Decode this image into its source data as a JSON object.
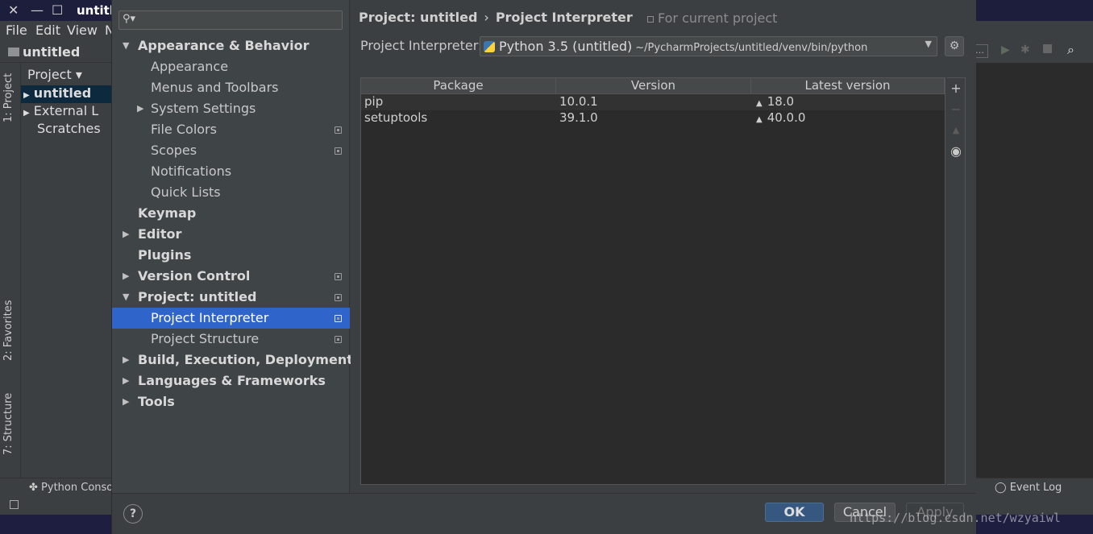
{
  "ide": {
    "title": "untitled",
    "menu": [
      "File",
      "Edit",
      "View",
      "N"
    ],
    "nav_crumb": "untitled",
    "project_header": "Project",
    "tree": [
      "untitled",
      "External L",
      "Scratches"
    ],
    "left_tabs": [
      "1: Project",
      "2: Favorites",
      "7: Structure"
    ],
    "python_console": "Python Conso",
    "event_log": "Event Log"
  },
  "dialog": {
    "search_placeholder": "",
    "nav": {
      "appearance_behavior": "Appearance & Behavior",
      "appearance": "Appearance",
      "menus_toolbars": "Menus and Toolbars",
      "system_settings": "System Settings",
      "file_colors": "File Colors",
      "scopes": "Scopes",
      "notifications": "Notifications",
      "quick_lists": "Quick Lists",
      "keymap": "Keymap",
      "editor": "Editor",
      "plugins": "Plugins",
      "version_control": "Version Control",
      "project_untitled": "Project: untitled",
      "project_interpreter": "Project Interpreter",
      "project_structure": "Project Structure",
      "build": "Build, Execution, Deployment",
      "languages": "Languages & Frameworks",
      "tools": "Tools"
    },
    "breadcrumb": {
      "project": "Project: untitled",
      "separator": "›",
      "page": "Project Interpreter"
    },
    "for_current_project": "For current project",
    "interpreter_label": "Project Interpreter:",
    "interpreter_name": "Python 3.5 (untitled)",
    "interpreter_path": "~/PycharmProjects/untitled/venv/bin/python",
    "table": {
      "headers": [
        "Package",
        "Version",
        "Latest version"
      ],
      "rows": [
        {
          "package": "pip",
          "version": "10.0.1",
          "latest": "18.0"
        },
        {
          "package": "setuptools",
          "version": "39.1.0",
          "latest": "40.0.0"
        }
      ]
    },
    "buttons": {
      "ok": "OK",
      "cancel": "Cancel",
      "apply": "Apply",
      "help": "?"
    }
  },
  "watermark": "https://blog.csdn.net/wzyaiwl",
  "colors": {
    "selection": "#2f65ca",
    "ok_button": "#365880",
    "accent_tab": "#e05a20"
  }
}
